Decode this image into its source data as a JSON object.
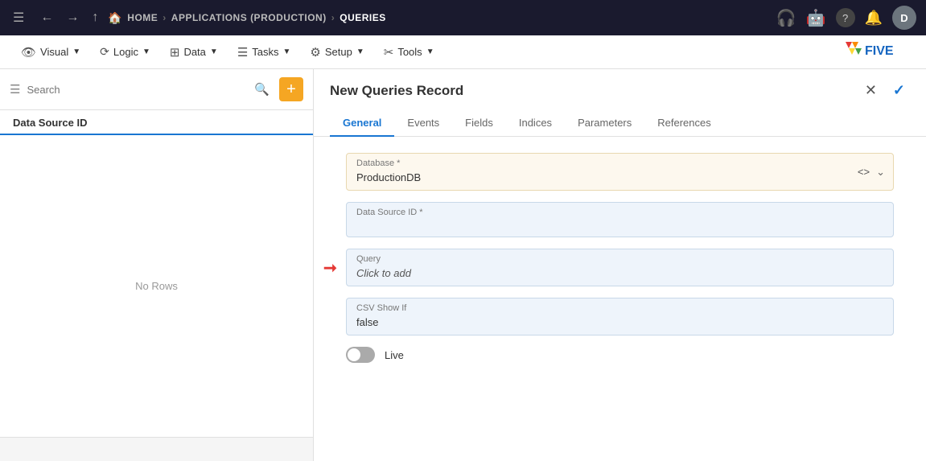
{
  "topnav": {
    "hamburger": "☰",
    "back_icon": "←",
    "forward_icon": "→",
    "up_icon": "↑",
    "home_label": "HOME",
    "breadcrumb_sep1": "›",
    "app_label": "APPLICATIONS (PRODUCTION)",
    "breadcrumb_sep2": "›",
    "queries_label": "QUERIES",
    "icons": {
      "headset": "🎧",
      "robot": "🤖",
      "help": "?",
      "bell": "🔔"
    },
    "avatar_letter": "D"
  },
  "menubar": {
    "items": [
      {
        "id": "visual",
        "icon": "👁",
        "label": "Visual"
      },
      {
        "id": "logic",
        "icon": "⟳",
        "label": "Logic"
      },
      {
        "id": "data",
        "icon": "⊞",
        "label": "Data"
      },
      {
        "id": "tasks",
        "icon": "☰",
        "label": "Tasks"
      },
      {
        "id": "setup",
        "icon": "⚙",
        "label": "Setup"
      },
      {
        "id": "tools",
        "icon": "✂",
        "label": "Tools"
      }
    ],
    "logo": "FIVE"
  },
  "sidebar": {
    "search_placeholder": "Search",
    "add_btn_label": "+",
    "column_header": "Data Source ID",
    "no_rows_text": "No Rows"
  },
  "content": {
    "title": "New Queries Record",
    "close_btn": "✕",
    "check_btn": "✓",
    "tabs": [
      {
        "id": "general",
        "label": "General",
        "active": true
      },
      {
        "id": "events",
        "label": "Events",
        "active": false
      },
      {
        "id": "fields",
        "label": "Fields",
        "active": false
      },
      {
        "id": "indices",
        "label": "Indices",
        "active": false
      },
      {
        "id": "parameters",
        "label": "Parameters",
        "active": false
      },
      {
        "id": "references",
        "label": "References",
        "active": false
      }
    ]
  },
  "form": {
    "database_label": "Database *",
    "database_value": "ProductionDB",
    "datasource_label": "Data Source ID *",
    "datasource_value": "",
    "query_label": "Query",
    "query_placeholder": "Click to add",
    "csv_showif_label": "CSV Show If",
    "csv_showif_value": "false",
    "live_label": "Live",
    "live_enabled": false
  }
}
